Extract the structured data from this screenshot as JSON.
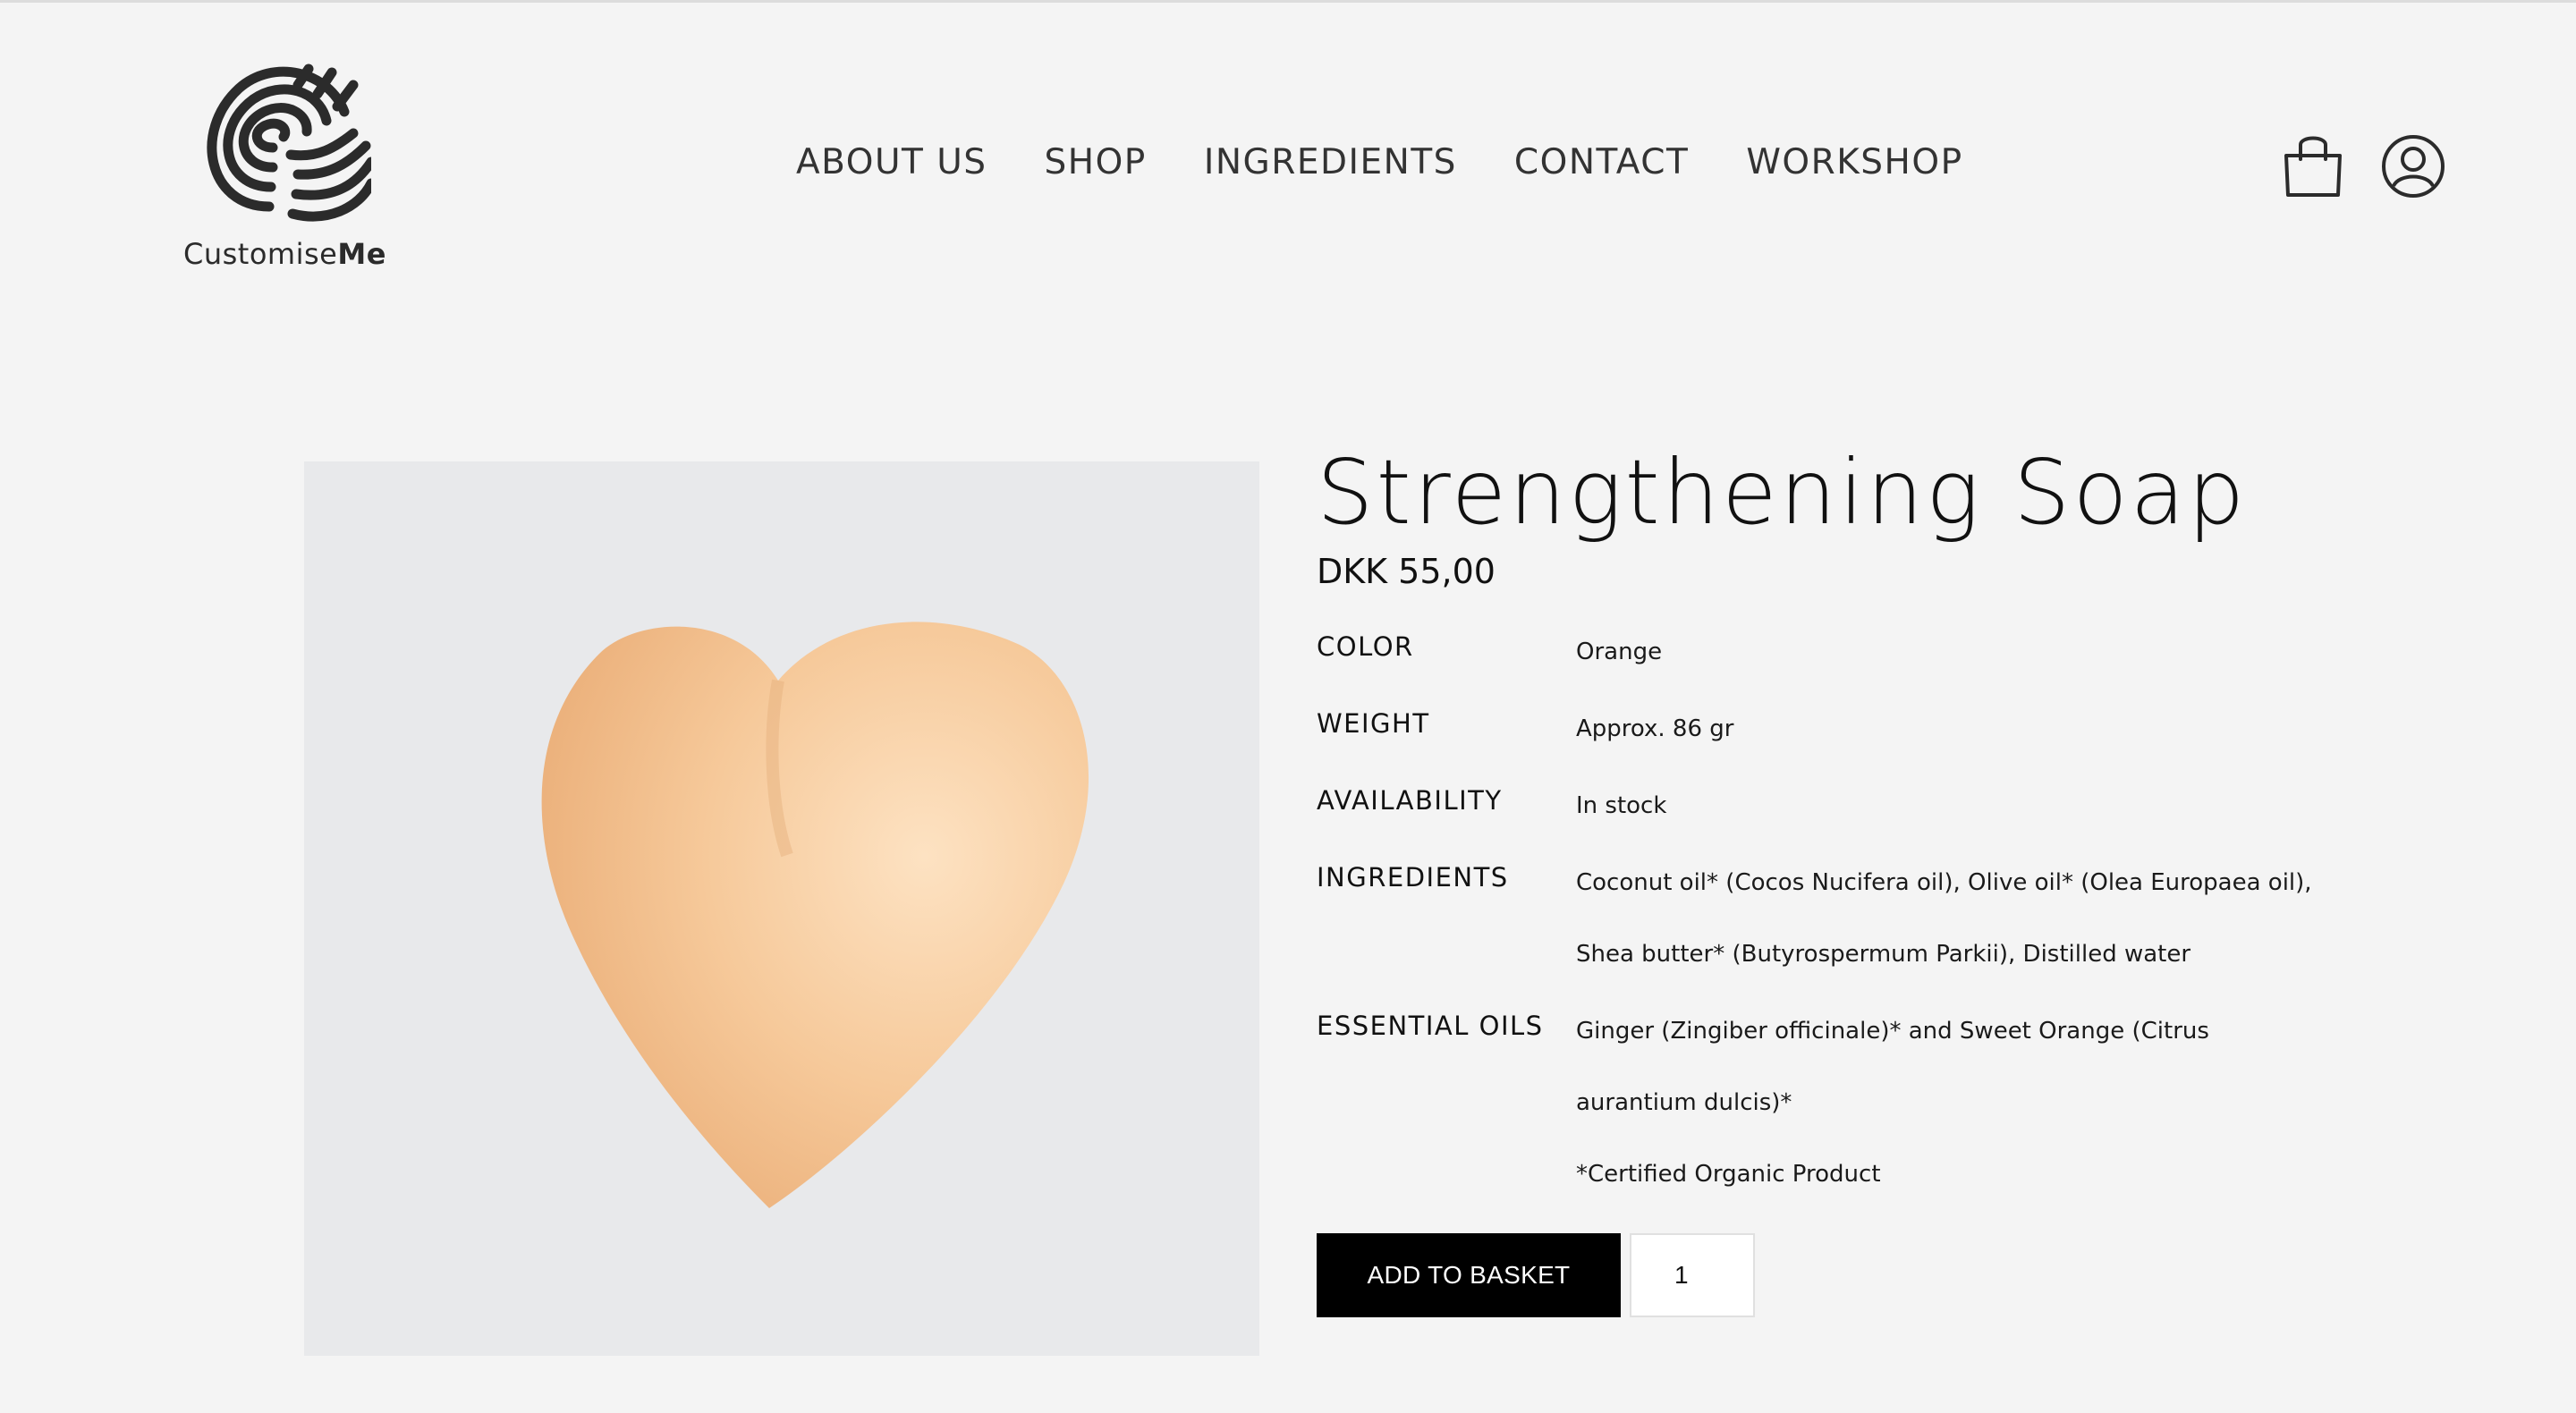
{
  "brand": {
    "name_regular": "Customise",
    "name_bold": "Me"
  },
  "nav": {
    "items": [
      {
        "label": "ABOUT US"
      },
      {
        "label": "SHOP"
      },
      {
        "label": "INGREDIENTS"
      },
      {
        "label": "CONTACT"
      },
      {
        "label": "WORKSHOP"
      }
    ]
  },
  "header_icons": [
    "shopping-bag-icon",
    "user-account-icon"
  ],
  "product": {
    "title": "Strengthening Soap",
    "price": "DKK 55,00",
    "specs": [
      {
        "label": "COLOR",
        "lines": [
          "Orange"
        ]
      },
      {
        "label": "WEIGHT",
        "lines": [
          "Approx. 86 gr"
        ]
      },
      {
        "label": "AVAILABILITY",
        "lines": [
          "In stock"
        ]
      },
      {
        "label": "INGREDIENTS",
        "lines": [
          "Coconut oil* (Cocos Nucifera oil), Olive oil* (Olea Europaea oil),",
          "Shea butter* (Butyrospermum Parkii), Distilled water"
        ]
      },
      {
        "label": "ESSENTIAL OILS",
        "lines": [
          "Ginger (Zingiber officinale)* and Sweet Orange (Citrus",
          "aurantium dulcis)*",
          "*Certified Organic Product"
        ]
      }
    ],
    "image_color": "#f2bf8c",
    "image_bg": "#e8e9eb"
  },
  "purchase": {
    "add_label": "ADD TO BASKET",
    "quantity": "1"
  }
}
